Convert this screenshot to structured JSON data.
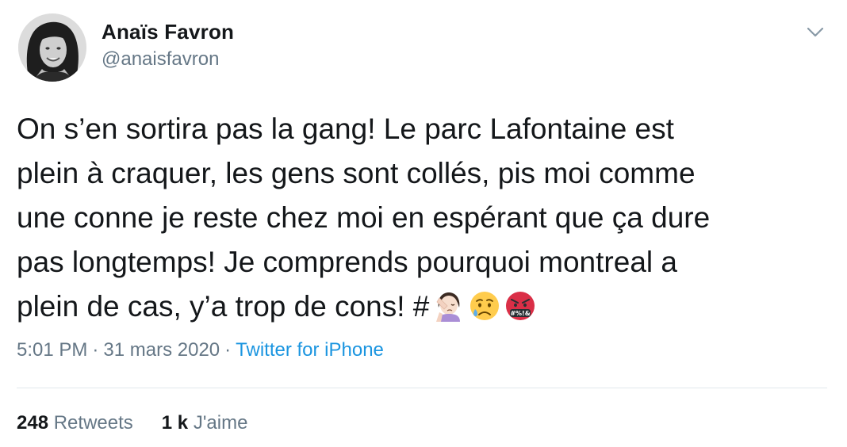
{
  "author": {
    "display_name": "Anaïs Favron",
    "handle": "@anaisfavron",
    "avatar_icon": "profile-photo"
  },
  "tweet": {
    "lines": [
      "On s’en sortira pas la gang! Le parc Lafontaine est",
      "plein à craquer, les gens sont collés, pis moi comme",
      "une conne je reste chez moi en espérant que ça dure",
      "pas longtemps! Je comprends pourquoi montreal a",
      "plein de cas, y’a trop de cons!"
    ],
    "hashtag_symbol": "#",
    "emojis": [
      "woman-facepalming-emoji",
      "crying-face-emoji",
      "face-with-symbols-on-mouth-emoji"
    ],
    "emoji_symbols_text": "#%!&"
  },
  "meta": {
    "time": "5:01 PM",
    "separator": "·",
    "date": "31 mars 2020",
    "source": "Twitter for iPhone"
  },
  "stats": {
    "retweets_count": "248",
    "retweets_label": "Retweets",
    "likes_count": "1 k",
    "likes_label": "J'aime"
  },
  "colors": {
    "text": "#14171a",
    "secondary": "#657786",
    "link": "#1b95e0",
    "divider": "#e1e8ed"
  }
}
